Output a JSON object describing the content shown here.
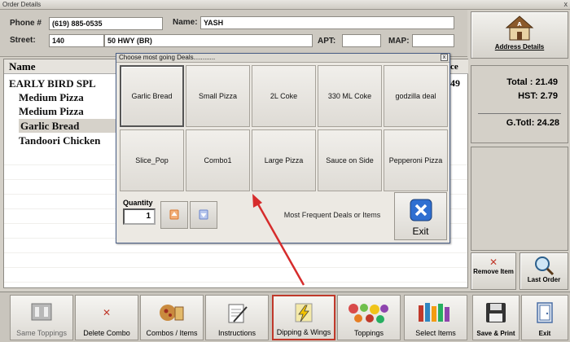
{
  "window": {
    "title": "Order Details",
    "close": "x"
  },
  "customer": {
    "phone_label": "Phone #",
    "phone": "(619) 885-0535",
    "name_label": "Name:",
    "name": "YASH",
    "street_label": "Street:",
    "street_no": "140",
    "street": "50 HWY  (BR)",
    "apt_label": "APT:",
    "apt": "",
    "map_label": "MAP:",
    "map": ""
  },
  "order": {
    "col_name": "Name",
    "col_price_fragment": "ce",
    "price_fragment": "49",
    "items": [
      {
        "name": "EARLY BIRD SPL",
        "indent": false,
        "selected": false
      },
      {
        "name": "Medium Pizza",
        "indent": true,
        "selected": false
      },
      {
        "name": "Medium Pizza",
        "indent": true,
        "selected": false
      },
      {
        "name": "Garlic Bread",
        "indent": true,
        "selected": true
      },
      {
        "name": "Tandoori Chicken",
        "indent": true,
        "selected": false
      }
    ]
  },
  "right_panel": {
    "address_details": "Address Details",
    "total_label": "Total :",
    "total": "21.49",
    "hst_label": "HST:",
    "hst": "2.79",
    "gtotal_label": "G.Totl:",
    "gtotal": "24.28",
    "remove_item": "Remove Item",
    "last_order": "Last Order",
    "save_print": "Save & Print",
    "exit": "Exit"
  },
  "dialog": {
    "title": "Choose most going Deals............",
    "close": "x",
    "deals": [
      "Garlic Bread",
      "Small Pizza",
      "2L Coke",
      "330 ML Coke",
      "godzilla deal",
      "Slice_Pop",
      "Combo1",
      "Large Pizza",
      "Sauce on Side",
      "Pepperoni Pizza"
    ],
    "quantity_label": "Quantity",
    "quantity": "1",
    "frequent_text": "Most Frequent Deals or Items",
    "exit_label": "Exit"
  },
  "toolbar": {
    "same_toppings": "Same Toppings",
    "delete_combo": "Delete Combo",
    "combos_items": "Combos / Items",
    "instructions": "Instructions",
    "dipping_wings": "Dipping & Wings",
    "toppings": "Toppings",
    "select_items": "Select Items"
  },
  "colors": {
    "highlight_box": "#c0392b",
    "arrow": "#d62c2c",
    "exit_icon": "#2f6fd1"
  }
}
